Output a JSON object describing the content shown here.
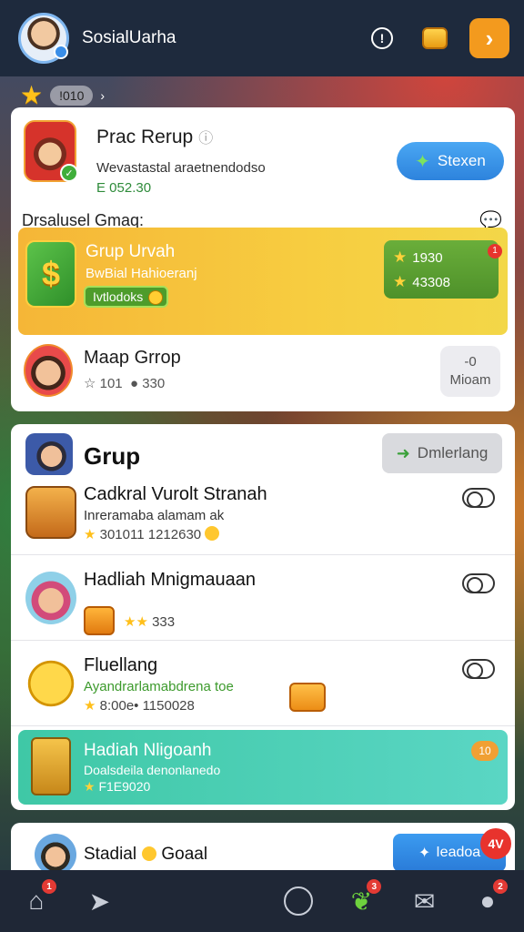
{
  "header": {
    "username": "SosialUarha",
    "info_icon": "info-icon",
    "coin_icon": "coin-box-icon",
    "forward_label": "›"
  },
  "substrip": {
    "badge": "!010",
    "trailing": "›"
  },
  "card1": {
    "title": "Prac Rerup",
    "subtitle": "Wevastastal araetnendodso",
    "amount": "E 052.30",
    "action_label": "Stexen",
    "section_label": "Drsalusel Gmaq:",
    "featured": {
      "title": "Grup Urvah",
      "subtitle": "BwBial Hahioeranj",
      "tag_label": "Ivtlodoks",
      "stat_1": "1930",
      "stat_2": "43308",
      "badge": "1"
    },
    "row": {
      "title": "Maap Grrop",
      "meta_1": "101",
      "meta_2": "330",
      "button_line1": "-0",
      "button_line2": "Mioam"
    }
  },
  "card2": {
    "title": "Grup",
    "action_label": "Dmlerlang",
    "items": [
      {
        "title": "Cadkral Vurolt Stranah",
        "subtitle": "Inreramaba alamam ak",
        "meta": "301011 1212630"
      },
      {
        "title": "Hadliah Mnigmauaan",
        "meta": "333"
      },
      {
        "title": "Fluellang",
        "subtitle": "Ayandrarlamabdrena",
        "subtitle_highlight": "toe",
        "meta": "8:00e• 1150028"
      }
    ],
    "highlight": {
      "title": "Hadiah Nligoanh",
      "subtitle": "Doalsdeila denonlanedo",
      "amount": "F1E9020",
      "badge": "10"
    }
  },
  "card3": {
    "title": "Stadial",
    "title_suffix": "Goaal",
    "action_label": "Ieadoa",
    "badge": "4V"
  },
  "bottomnav": {
    "items": [
      {
        "name": "home-icon",
        "badge": "1"
      },
      {
        "name": "send-icon",
        "badge": ""
      },
      {
        "name": "clock-icon",
        "badge": ""
      },
      {
        "name": "leaf-icon",
        "badge": "3"
      },
      {
        "name": "mail-icon",
        "badge": ""
      },
      {
        "name": "user-icon",
        "badge": "2"
      }
    ]
  },
  "colors": {
    "topbar": "#1e2a3d",
    "accent_orange": "#f39a1e",
    "accent_blue": "#2d83dd",
    "featured_yellow": "#f7cd40",
    "highlight_teal": "#3fc8a6",
    "badge_red": "#e33a34"
  }
}
